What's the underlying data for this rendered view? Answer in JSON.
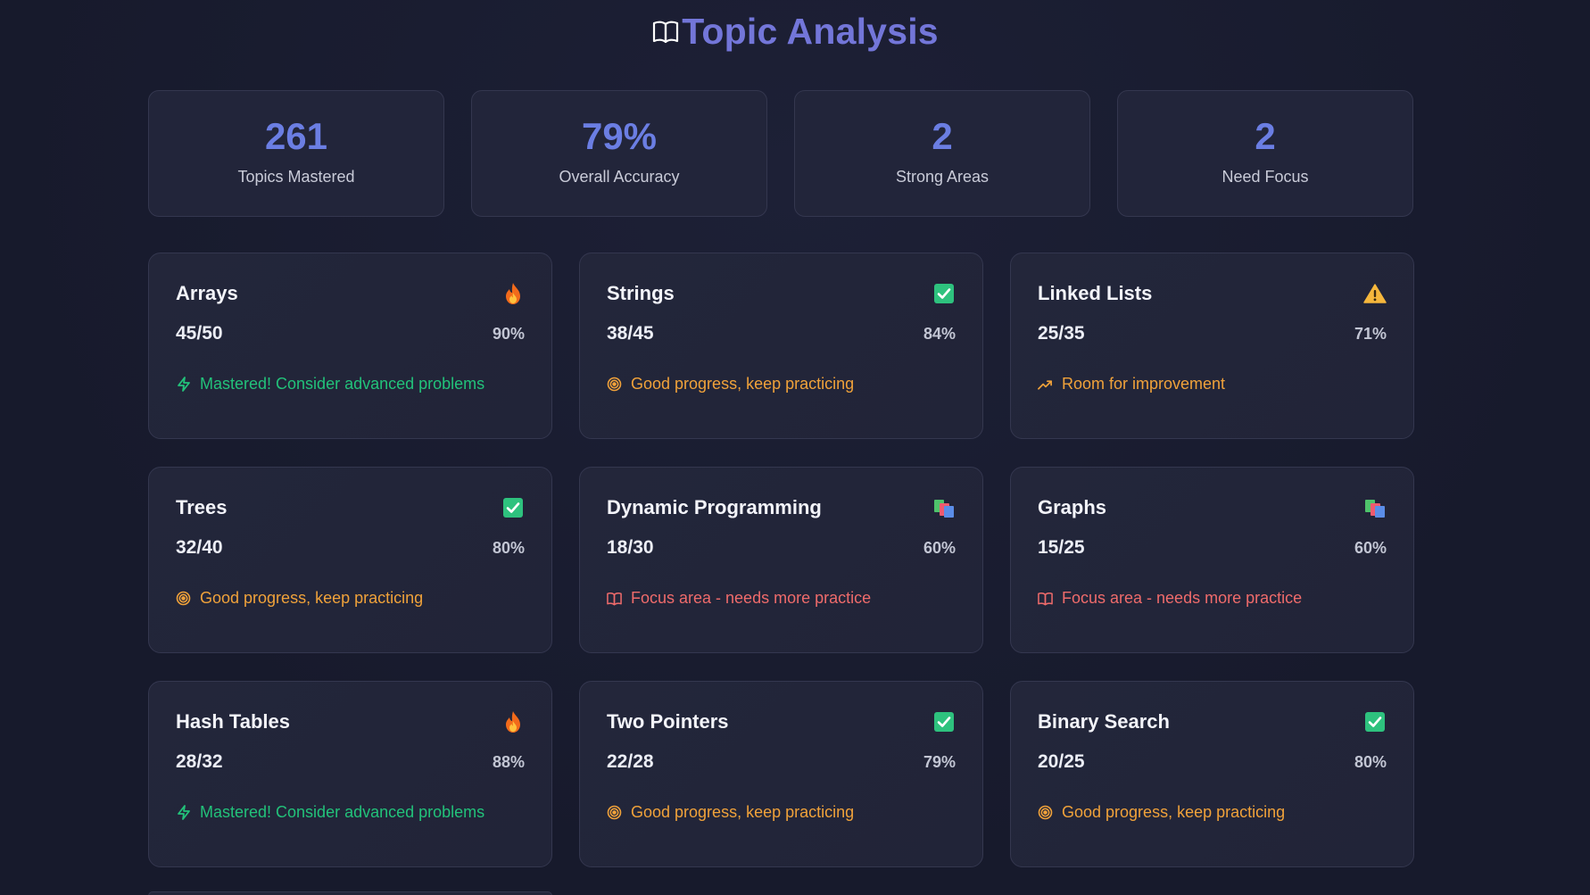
{
  "header": {
    "title": "Topic Analysis",
    "icon": "open-book-icon"
  },
  "stats": [
    {
      "value": "261",
      "label": "Topics Mastered"
    },
    {
      "value": "79%",
      "label": "Overall Accuracy"
    },
    {
      "value": "2",
      "label": "Strong Areas"
    },
    {
      "value": "2",
      "label": "Need Focus"
    }
  ],
  "topics": [
    {
      "name": "Arrays",
      "ratio": "45/50",
      "percent": "90%",
      "icon": "fire-icon",
      "message": "Mastered! Consider advanced problems",
      "message_icon": "lightning-icon",
      "tone": "green"
    },
    {
      "name": "Strings",
      "ratio": "38/45",
      "percent": "84%",
      "icon": "check-box-icon",
      "message": "Good progress, keep practicing",
      "message_icon": "target-icon",
      "tone": "orange"
    },
    {
      "name": "Linked Lists",
      "ratio": "25/35",
      "percent": "71%",
      "icon": "warning-icon",
      "message": "Room for improvement",
      "message_icon": "trending-up-icon",
      "tone": "orange"
    },
    {
      "name": "Trees",
      "ratio": "32/40",
      "percent": "80%",
      "icon": "check-box-icon",
      "message": "Good progress, keep practicing",
      "message_icon": "target-icon",
      "tone": "orange"
    },
    {
      "name": "Dynamic Programming",
      "ratio": "18/30",
      "percent": "60%",
      "icon": "books-icon",
      "message": "Focus area - needs more practice",
      "message_icon": "book-icon",
      "tone": "red"
    },
    {
      "name": "Graphs",
      "ratio": "15/25",
      "percent": "60%",
      "icon": "books-icon",
      "message": "Focus area - needs more practice",
      "message_icon": "book-icon",
      "tone": "red"
    },
    {
      "name": "Hash Tables",
      "ratio": "28/32",
      "percent": "88%",
      "icon": "fire-icon",
      "message": "Mastered! Consider advanced problems",
      "message_icon": "lightning-icon",
      "tone": "green"
    },
    {
      "name": "Two Pointers",
      "ratio": "22/28",
      "percent": "79%",
      "icon": "check-box-icon",
      "message": "Good progress, keep practicing",
      "message_icon": "target-icon",
      "tone": "orange"
    },
    {
      "name": "Binary Search",
      "ratio": "20/25",
      "percent": "80%",
      "icon": "check-box-icon",
      "message": "Good progress, keep practicing",
      "message_icon": "target-icon",
      "tone": "orange"
    }
  ],
  "colors": {
    "background": "#181a2e",
    "card": "#22253a",
    "accent": "#6b7ee3",
    "title": "#7376d9",
    "green": "#22c27a",
    "orange": "#f0a23a",
    "red": "#ef6b6b"
  }
}
